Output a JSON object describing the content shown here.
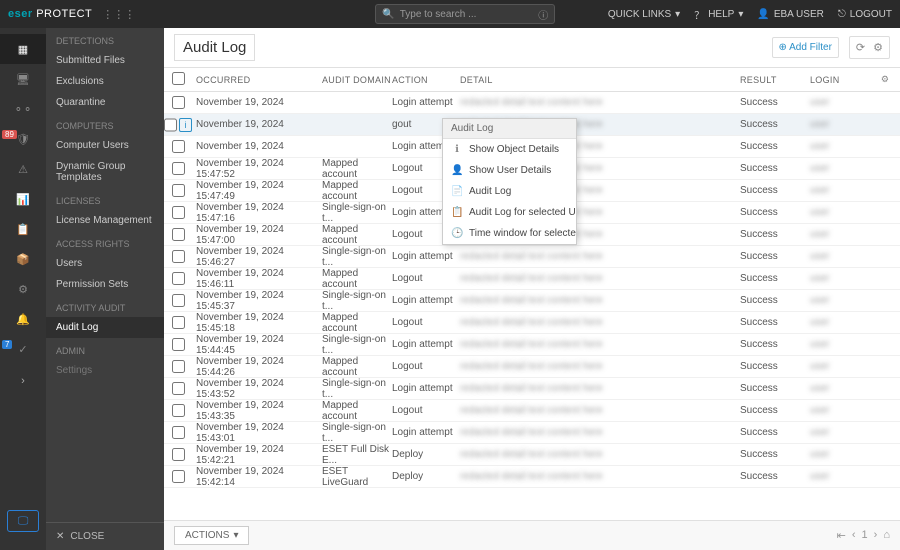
{
  "brand": {
    "e": "eser",
    "protect": "PROTECT"
  },
  "search": {
    "placeholder": "Type to search ..."
  },
  "top": {
    "quicklinks": "QUICK LINKS",
    "help": "HELP",
    "user": "EBA USER",
    "logout": "LOGOUT"
  },
  "sidebar": {
    "sections": [
      {
        "title": "DETECTIONS",
        "items": [
          "Submitted Files",
          "Exclusions",
          "Quarantine"
        ]
      },
      {
        "title": "COMPUTERS",
        "items": [
          "Computer Users",
          "Dynamic Group Templates"
        ]
      },
      {
        "title": "LICENSES",
        "items": [
          "License Management"
        ]
      },
      {
        "title": "ACCESS RIGHTS",
        "items": [
          "Users",
          "Permission Sets"
        ]
      },
      {
        "title": "ACTIVITY AUDIT",
        "items": [
          "Audit Log"
        ]
      },
      {
        "title": "ADMIN",
        "items": [
          "Settings"
        ]
      }
    ],
    "active": "Audit Log",
    "close": "CLOSE"
  },
  "page": {
    "title": "Audit Log",
    "add_filter": "Add Filter"
  },
  "columns": {
    "occurred": "OCCURRED",
    "domain": "AUDIT DOMAIN",
    "action": "ACTION",
    "detail": "DETAIL",
    "result": "RESULT",
    "login": "LOGIN"
  },
  "context": {
    "header": "Audit Log",
    "items": [
      {
        "icon": "ℹ",
        "label": "Show Object Details"
      },
      {
        "icon": "👤",
        "label": "Show User Details"
      },
      {
        "icon": "📄",
        "label": "Audit Log"
      },
      {
        "icon": "📋",
        "label": "Audit Log for selected User"
      },
      {
        "icon": "🕒",
        "label": "Time window for selected object"
      }
    ]
  },
  "rows": [
    {
      "occurred": "November 19, 2024",
      "domain": "",
      "action": "Login attempt",
      "result": "Success"
    },
    {
      "occurred": "November 19, 2024",
      "domain": "",
      "action": "gout",
      "result": "Success",
      "selected": true
    },
    {
      "occurred": "November 19, 2024",
      "domain": "",
      "action": "Login attempt",
      "result": "Success"
    },
    {
      "occurred": "November 19, 2024 15:47:52",
      "domain": "Mapped account",
      "action": "Logout",
      "result": "Success"
    },
    {
      "occurred": "November 19, 2024 15:47:49",
      "domain": "Mapped account",
      "action": "Logout",
      "result": "Success"
    },
    {
      "occurred": "November 19, 2024 15:47:16",
      "domain": "Single-sign-on t...",
      "action": "Login attempt",
      "result": "Success"
    },
    {
      "occurred": "November 19, 2024 15:47:00",
      "domain": "Mapped account",
      "action": "Logout",
      "result": "Success"
    },
    {
      "occurred": "November 19, 2024 15:46:27",
      "domain": "Single-sign-on t...",
      "action": "Login attempt",
      "result": "Success"
    },
    {
      "occurred": "November 19, 2024 15:46:11",
      "domain": "Mapped account",
      "action": "Logout",
      "result": "Success"
    },
    {
      "occurred": "November 19, 2024 15:45:37",
      "domain": "Single-sign-on t...",
      "action": "Login attempt",
      "result": "Success"
    },
    {
      "occurred": "November 19, 2024 15:45:18",
      "domain": "Mapped account",
      "action": "Logout",
      "result": "Success"
    },
    {
      "occurred": "November 19, 2024 15:44:45",
      "domain": "Single-sign-on t...",
      "action": "Login attempt",
      "result": "Success"
    },
    {
      "occurred": "November 19, 2024 15:44:26",
      "domain": "Mapped account",
      "action": "Logout",
      "result": "Success"
    },
    {
      "occurred": "November 19, 2024 15:43:52",
      "domain": "Single-sign-on t...",
      "action": "Login attempt",
      "result": "Success"
    },
    {
      "occurred": "November 19, 2024 15:43:35",
      "domain": "Mapped account",
      "action": "Logout",
      "result": "Success"
    },
    {
      "occurred": "November 19, 2024 15:43:01",
      "domain": "Single-sign-on t...",
      "action": "Login attempt",
      "result": "Success"
    },
    {
      "occurred": "November 19, 2024 15:42:21",
      "domain": "ESET Full Disk E...",
      "action": "Deploy",
      "result": "Success"
    },
    {
      "occurred": "November 19, 2024 15:42:14",
      "domain": "ESET LiveGuard",
      "action": "Deploy",
      "result": "Success"
    }
  ],
  "badges": {
    "red": "89",
    "blue": "7"
  },
  "footer": {
    "actions": "ACTIONS"
  }
}
